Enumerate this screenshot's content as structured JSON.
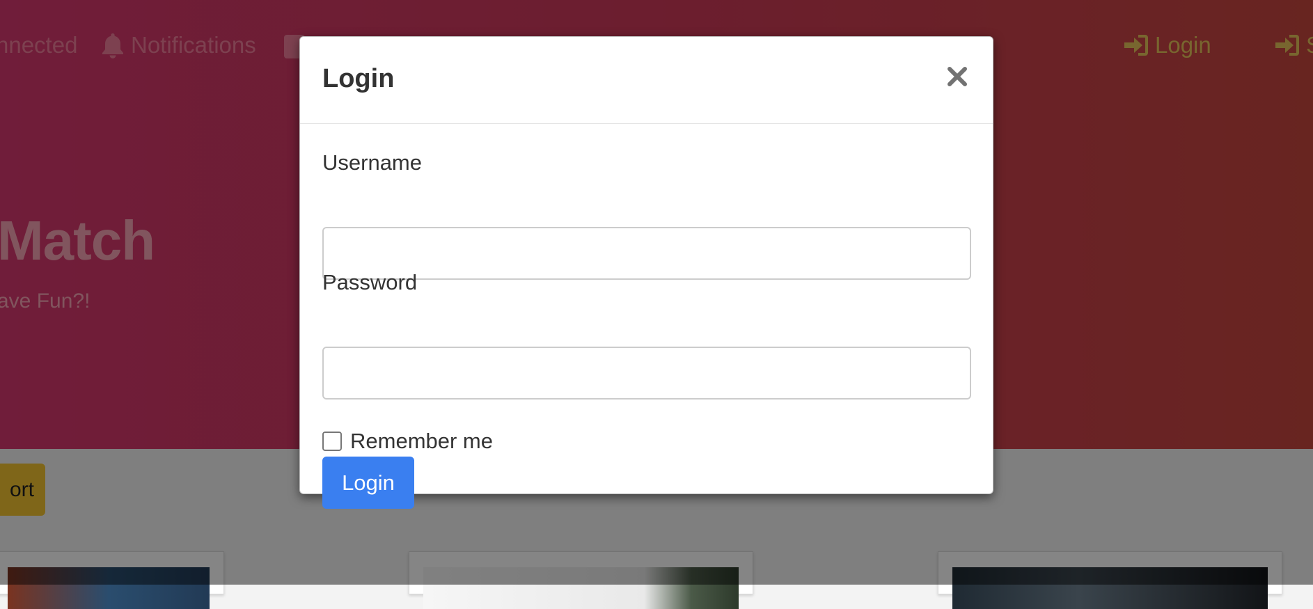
{
  "background": {
    "nav": {
      "connected": "nnected",
      "notifications": "Notifications",
      "login": "Login",
      "signup": "S"
    },
    "hero": {
      "title": "Match",
      "subtitle": "ave Fun?!"
    },
    "sort_button": "ort"
  },
  "modal": {
    "title": "Login",
    "close_symbol": "×",
    "username_label": "Username",
    "username_value": "",
    "password_label": "Password",
    "password_value": "",
    "remember_label": "Remember me",
    "remember_checked": false,
    "submit_label": "Login"
  },
  "colors": {
    "hero_left": "#d7396f",
    "hero_right": "#c8473f",
    "nav_pink": "#ef7e9a",
    "nav_gold": "#e7c35a",
    "primary_button": "#3a7ff0",
    "sort_button": "#f4c430"
  },
  "icons": {
    "notifications": "bell-icon",
    "login": "sign-in-icon",
    "signup": "sign-in-icon",
    "profile": "id-card-icon",
    "close": "close-icon"
  }
}
